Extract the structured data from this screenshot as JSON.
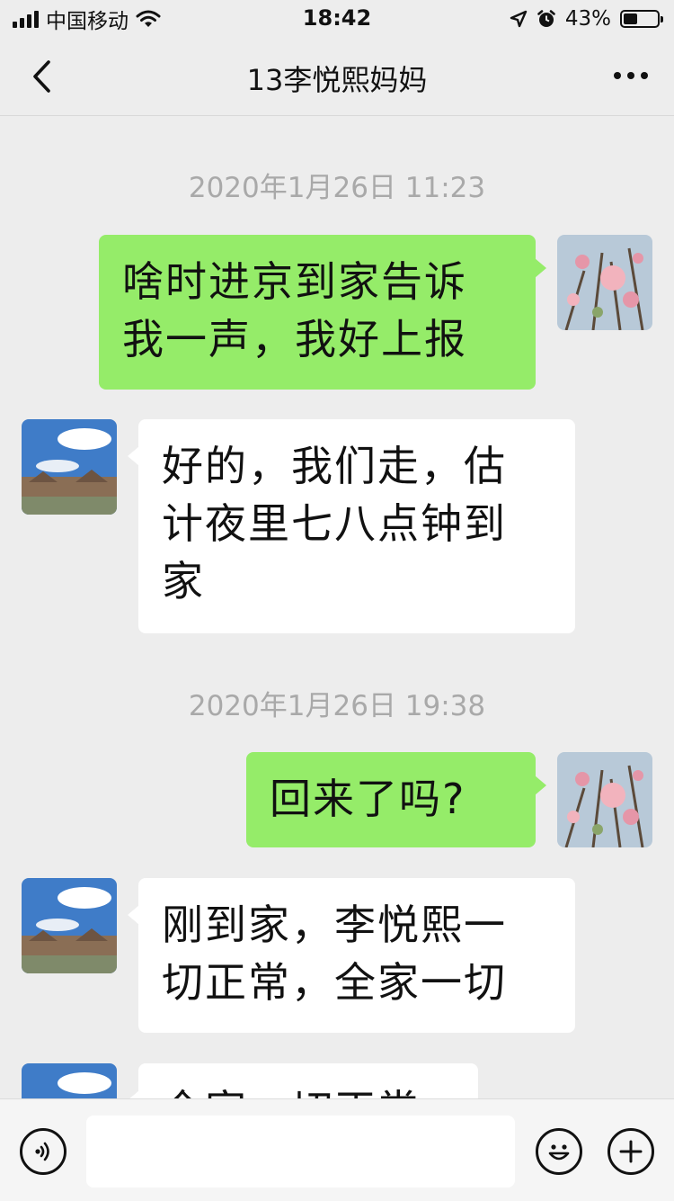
{
  "status_bar": {
    "carrier": "中国移动",
    "time": "18:42",
    "battery_percent": "43%",
    "battery_level": 0.43,
    "icons": [
      "signal-icon",
      "wifi-icon",
      "location-icon",
      "alarm-icon",
      "battery-icon"
    ]
  },
  "nav": {
    "back_icon": "chevron-left-icon",
    "title": "13李悦熙妈妈",
    "more_icon": "more-icon"
  },
  "messages": [
    {
      "type": "timestamp",
      "text": "2020年1月26日 11:23"
    },
    {
      "type": "message",
      "sender": "me",
      "lines": [
        "啥时进京到家告诉",
        "我一声，我好上报"
      ]
    },
    {
      "type": "message",
      "sender": "other",
      "lines": [
        "好的，我们走，估",
        "计夜里七八点钟到",
        "家"
      ]
    },
    {
      "type": "timestamp",
      "text": "2020年1月26日 19:38"
    },
    {
      "type": "message",
      "sender": "me",
      "lines": [
        "回来了吗?"
      ]
    },
    {
      "type": "message",
      "sender": "other",
      "lines": [
        "刚到家，李悦熙一",
        "切正常，全家一切"
      ]
    },
    {
      "type": "message",
      "sender": "other",
      "lines": [
        "全家一切正常"
      ]
    }
  ],
  "input_bar": {
    "voice_icon": "voice-icon",
    "emoji_icon": "emoji-icon",
    "plus_icon": "plus-icon",
    "input_value": ""
  },
  "colors": {
    "background": "#ededed",
    "my_bubble": "#95ec69",
    "other_bubble": "#ffffff",
    "timestamp_text": "#a9a9a9"
  }
}
